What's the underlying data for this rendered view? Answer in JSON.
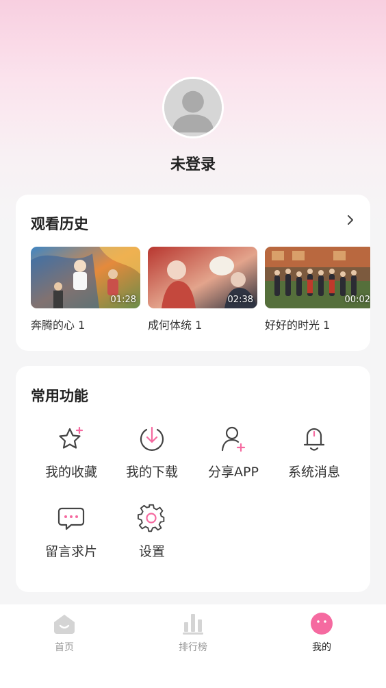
{
  "profile": {
    "name": "未登录",
    "avatar_icon": "default-user-avatar"
  },
  "history": {
    "title": "观看历史",
    "more_icon": "chevron-right-icon",
    "items": [
      {
        "title": "奔腾的心 1",
        "duration": "01:28"
      },
      {
        "title": "成何体统 1",
        "duration": "02:38"
      },
      {
        "title": "好好的时光 1",
        "duration": "00:02"
      }
    ]
  },
  "features": {
    "title": "常用功能",
    "items": [
      {
        "label": "我的收藏",
        "icon": "star-plus-icon"
      },
      {
        "label": "我的下载",
        "icon": "download-icon"
      },
      {
        "label": "分享APP",
        "icon": "user-plus-icon"
      },
      {
        "label": "系统消息",
        "icon": "bell-icon"
      },
      {
        "label": "留言求片",
        "icon": "message-icon"
      },
      {
        "label": "设置",
        "icon": "settings-gear-icon"
      }
    ]
  },
  "tabbar": {
    "items": [
      {
        "label": "首页",
        "icon": "home-icon",
        "active": false
      },
      {
        "label": "排行榜",
        "icon": "ranking-icon",
        "active": false
      },
      {
        "label": "我的",
        "icon": "profile-face-icon",
        "active": true
      }
    ]
  },
  "colors": {
    "accent": "#f56aa0",
    "icon_stroke": "#444444",
    "hero_top": "#f8cfe0",
    "background": "#f5f5f6",
    "tab_inactive": "#999999"
  }
}
